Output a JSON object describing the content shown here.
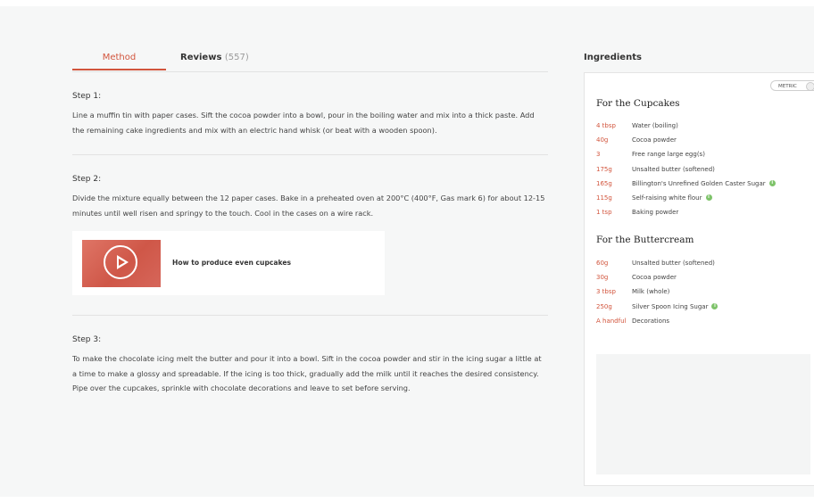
{
  "tabs": {
    "method_label": "Method",
    "reviews_label": "Reviews",
    "reviews_count": "(557)"
  },
  "steps": [
    {
      "title": "Step 1:",
      "text": "Line a muffin tin with paper cases. Sift the cocoa powder into a bowl, pour in the boiling water and mix into a thick paste. Add the remaining cake ingredients and mix with an electric hand whisk (or beat with a wooden spoon)."
    },
    {
      "title": "Step 2:",
      "text": "Divide the mixture equally between the 12 paper cases. Bake in a preheated oven at 200°C (400°F, Gas mark 6) for about 12-15 minutes until well risen and springy to the touch. Cool in the cases on a wire rack."
    },
    {
      "title": "Step 3:",
      "text": "To make the chocolate icing melt the butter and pour it into a bowl. Sift in the cocoa powder and stir in the icing sugar a little at a time to make a glossy and spreadable. If the icing is too thick, gradually add the milk until it reaches the desired consistency. Pipe over the cupcakes, sprinkle with chocolate decorations and leave to set before serving."
    }
  ],
  "video": {
    "title": "How to produce even cupcakes",
    "icon": "play-icon"
  },
  "ingredients": {
    "header": "Ingredients",
    "unit_toggle": "METRIC",
    "cupcakes": {
      "title": "For the Cupcakes",
      "items": [
        {
          "qty": "4 tbsp",
          "name": "Water (boiling)"
        },
        {
          "qty": "40g",
          "name": "Cocoa powder"
        },
        {
          "qty": "3",
          "name": "Free range large egg(s)"
        },
        {
          "qty": "175g",
          "name": "Unsalted butter (softened)"
        },
        {
          "qty": "165g",
          "name": "Billington's Unrefined Golden Caster Sugar",
          "info": "i"
        },
        {
          "qty": "115g",
          "name": "Self-raising white flour",
          "info": "i"
        },
        {
          "qty": "1 tsp",
          "name": "Baking powder"
        }
      ]
    },
    "buttercream": {
      "title": "For the Buttercream",
      "items": [
        {
          "qty": "60g",
          "name": "Unsalted butter (softened)"
        },
        {
          "qty": "30g",
          "name": "Cocoa powder"
        },
        {
          "qty": "3 tbsp",
          "name": "Milk (whole)"
        },
        {
          "qty": "250g",
          "name": "Silver Spoon Icing Sugar",
          "info": "i"
        },
        {
          "qty": "A handful",
          "name": "Decorations"
        }
      ]
    }
  },
  "colors": {
    "accent": "#d2553d",
    "info_badge": "#7ec36a",
    "background": "#f6f7f7"
  }
}
